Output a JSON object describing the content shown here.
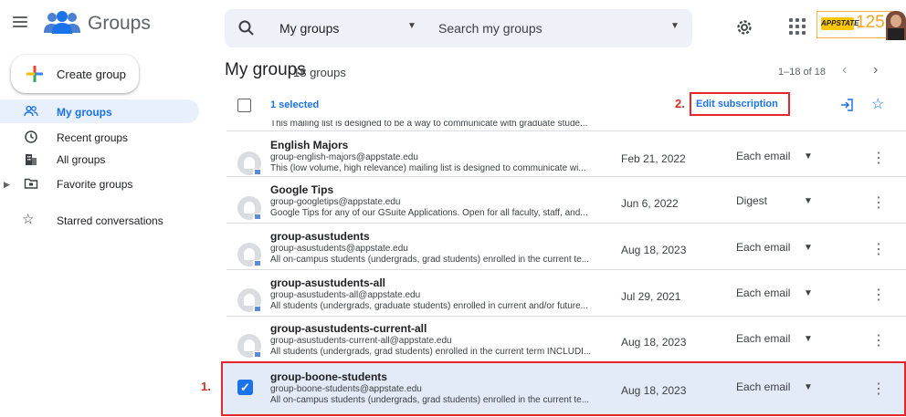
{
  "app": {
    "title": "Groups"
  },
  "search": {
    "scope": "My groups",
    "placeholder": "Search my groups"
  },
  "brand": {
    "badge_text": "APPSTATE",
    "number": "125"
  },
  "sidebar": {
    "create_label": "Create group",
    "items": [
      {
        "label": "My groups",
        "icon": "people-icon",
        "active": true
      },
      {
        "label": "Recent groups",
        "icon": "clock-icon"
      },
      {
        "label": "All groups",
        "icon": "building-icon"
      },
      {
        "label": "Favorite groups",
        "icon": "folder-icon"
      },
      {
        "label": "Starred conversations",
        "icon": "star-icon"
      }
    ]
  },
  "main": {
    "title": "My groups",
    "count": "18 groups",
    "pagination": "1–18 of 18",
    "selected_label": "1 selected",
    "edit_subscription": "Edit subscription",
    "scrolled_text": "This mailing list is designed to be a way to communicate with graduate stude..."
  },
  "annotations": {
    "step1": "1.",
    "step2": "2."
  },
  "groups": [
    {
      "name": "English Majors",
      "email": "group-english-majors@appstate.edu",
      "desc": "This (low volume, high relevance) mailing list is designed to communicate wi...",
      "date": "Feb 21, 2022",
      "subscription": "Each email"
    },
    {
      "name": "Google Tips",
      "email": "group-googletips@appstate.edu",
      "desc": "Google Tips for any of our GSuite Applications. Open for all faculty, staff, and...",
      "date": "Jun 6, 2022",
      "subscription": "Digest"
    },
    {
      "name": "group-asustudents",
      "email": "group-asustudents@appstate.edu",
      "desc": "All on-campus students (undergrads, grad students) enrolled in the current te...",
      "date": "Aug 18, 2023",
      "subscription": "Each email"
    },
    {
      "name": "group-asustudents-all",
      "email": "group-asustudents-all@appstate.edu",
      "desc": "All students (undergrads, graduate students) enrolled in current and/or future...",
      "date": "Jul 29, 2021",
      "subscription": "Each email"
    },
    {
      "name": "group-asustudents-current-all",
      "email": "group-asustudents-current-all@appstate.edu",
      "desc": "All students (undergrads, grad students) enrolled in the current term INCLUDI...",
      "date": "Aug 18, 2023",
      "subscription": "Each email"
    },
    {
      "name": "group-boone-students",
      "email": "group-boone-students@appstate.edu",
      "desc": "All on-campus students (undergrads, grad students) enrolled in the current te...",
      "date": "Aug 18, 2023",
      "subscription": "Each email",
      "selected": true
    }
  ],
  "colors": {
    "accent": "#1a73e8",
    "annotation_red": "#e4262d",
    "selected_row": "#e3ebf8",
    "search_bg": "#eef2f8"
  }
}
